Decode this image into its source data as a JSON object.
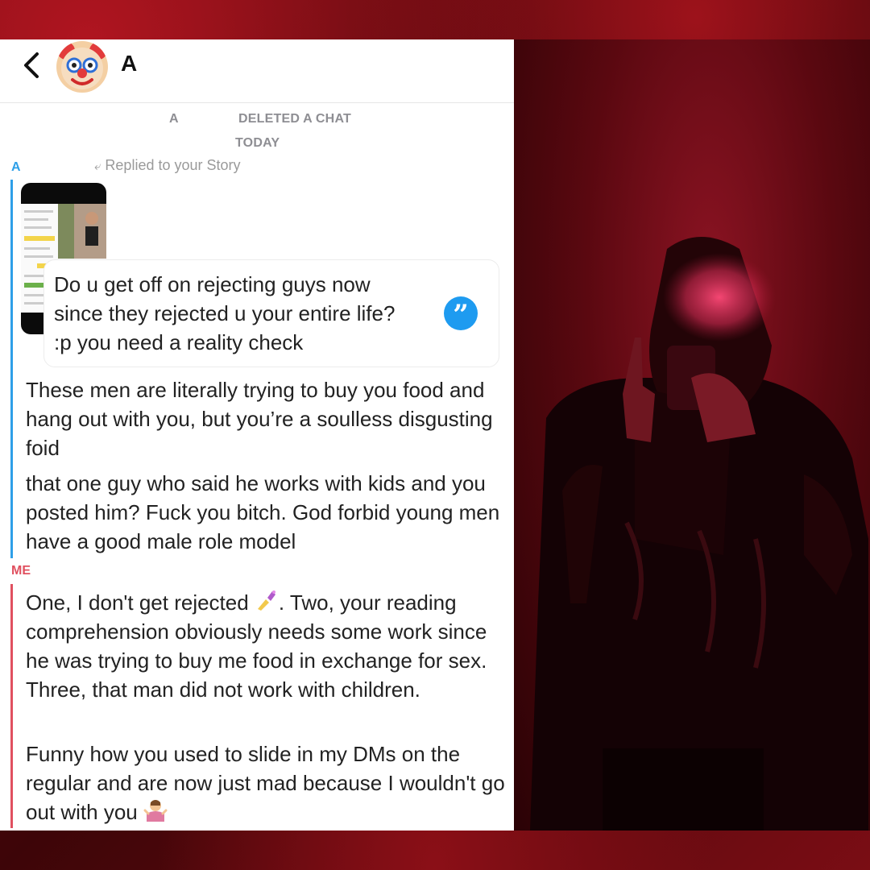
{
  "header": {
    "name": "A"
  },
  "system": {
    "sender": "A",
    "deleted": "DELETED A CHAT",
    "date": "TODAY"
  },
  "sender_label": "A",
  "reply_label": "Replied to your Story",
  "quoted_message": "Do u get off on rejecting guys now since they rejected u your entire life? :p you need a reality check",
  "their_messages": [
    "These men are literally trying to buy you food and hang out with you, but you’re a soulless disgusting foid",
    "that one guy who said he works with kids and you posted him? Fuck you bitch. God forbid young men have a good male role model"
  ],
  "me_label": "ME",
  "my_messages": {
    "m1_before": "One, I don't get rejected ",
    "m1_after": ". Two, your reading comprehension obviously needs some work since he was trying to buy me food in exchange for sex. Three, that man did not work with children.",
    "m2_before": "Funny how you used to slide in my DMs on the regular and are now just mad because I wouldn't go out with you "
  },
  "colors": {
    "their_accent": "#2e9fe8",
    "my_accent": "#e0505f",
    "quote_icon": "#1e9bf0"
  },
  "icons": [
    "back-chevron-icon",
    "clown-emoji-avatar",
    "reply-arrow-icon",
    "quote-icon",
    "nail-polish-emoji",
    "shrug-emoji"
  ]
}
